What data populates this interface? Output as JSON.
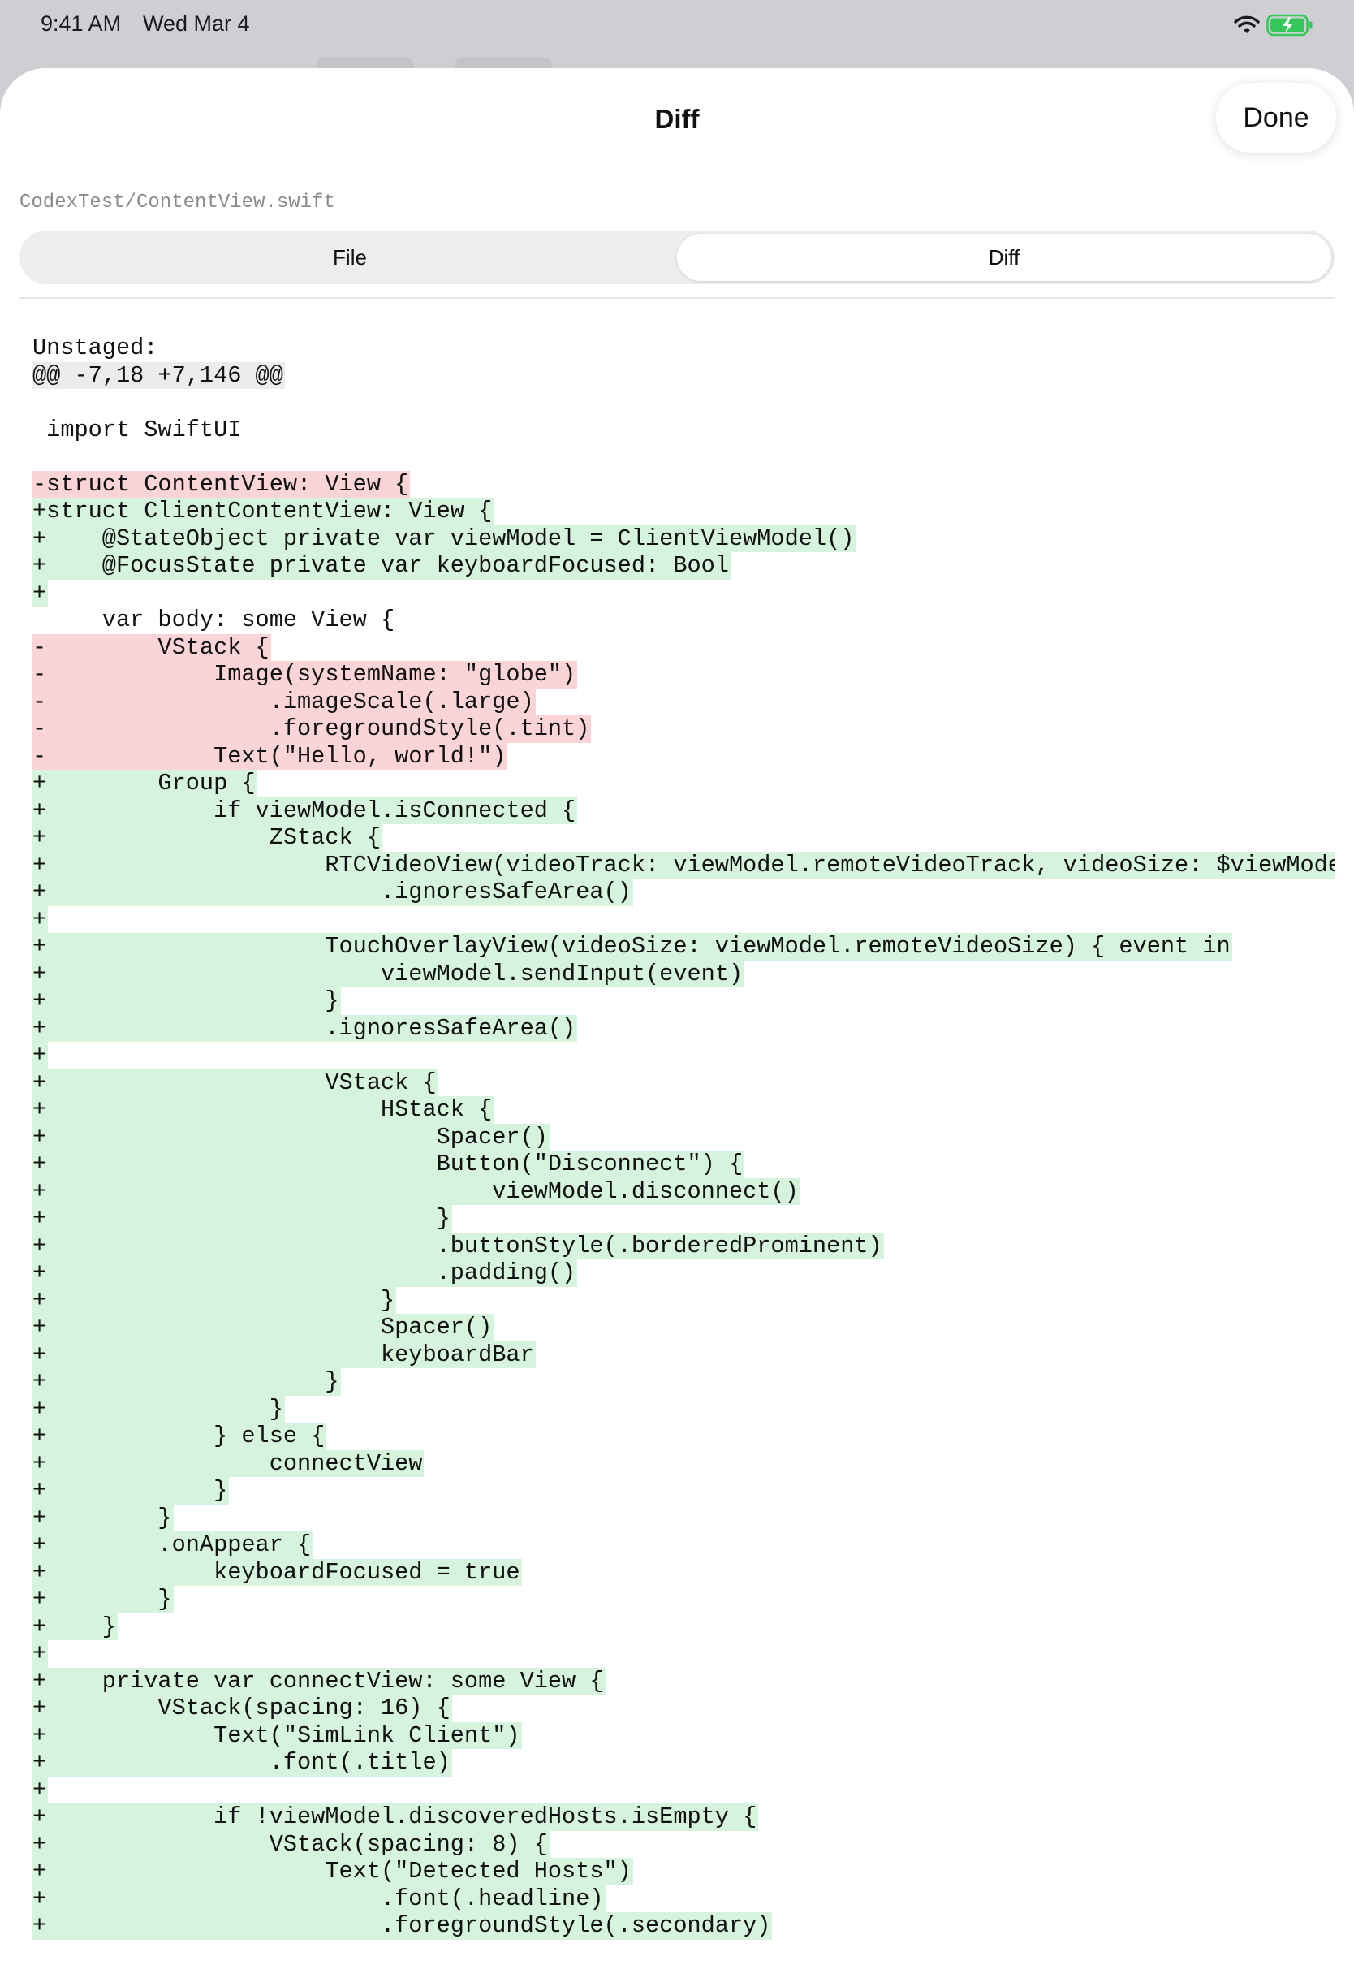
{
  "status_bar": {
    "time": "9:41 AM",
    "date": "Wed Mar 4"
  },
  "sheet": {
    "title": "Diff",
    "done_label": "Done",
    "file_path": "CodexTest/ContentView.swift"
  },
  "segments": {
    "file": "File",
    "diff": "Diff",
    "selected": "Diff"
  },
  "colors": {
    "added_bg": "#d5f3dd",
    "removed_bg": "#fad4d6",
    "hunk_bg": "#ececee",
    "battery": "#34c759"
  },
  "diff": {
    "lines": [
      {
        "type": "label",
        "text": "Unstaged:"
      },
      {
        "type": "hunk",
        "text": "@@ -7,18 +7,146 @@"
      },
      {
        "type": "blank",
        "text": ""
      },
      {
        "type": "ctx",
        "text": " import SwiftUI"
      },
      {
        "type": "blank",
        "text": ""
      },
      {
        "type": "del",
        "text": "-struct ContentView: View {"
      },
      {
        "type": "add",
        "text": "+struct ClientContentView: View {"
      },
      {
        "type": "add",
        "text": "+    @StateObject private var viewModel = ClientViewModel()"
      },
      {
        "type": "add",
        "text": "+    @FocusState private var keyboardFocused: Bool"
      },
      {
        "type": "add",
        "text": "+"
      },
      {
        "type": "ctx",
        "text": "     var body: some View {"
      },
      {
        "type": "del",
        "text": "-        VStack {"
      },
      {
        "type": "del",
        "text": "-            Image(systemName: \"globe\")"
      },
      {
        "type": "del",
        "text": "-                .imageScale(.large)"
      },
      {
        "type": "del",
        "text": "-                .foregroundStyle(.tint)"
      },
      {
        "type": "del",
        "text": "-            Text(\"Hello, world!\")"
      },
      {
        "type": "add",
        "text": "+        Group {"
      },
      {
        "type": "add",
        "text": "+            if viewModel.isConnected {"
      },
      {
        "type": "add",
        "text": "+                ZStack {"
      },
      {
        "type": "add",
        "text": "+                    RTCVideoView(videoTrack: viewModel.remoteVideoTrack, videoSize: $viewModel.remoteVideoSize)"
      },
      {
        "type": "add",
        "text": "+                        .ignoresSafeArea()"
      },
      {
        "type": "add",
        "text": "+"
      },
      {
        "type": "add",
        "text": "+                    TouchOverlayView(videoSize: viewModel.remoteVideoSize) { event in"
      },
      {
        "type": "add",
        "text": "+                        viewModel.sendInput(event)"
      },
      {
        "type": "add",
        "text": "+                    }"
      },
      {
        "type": "add",
        "text": "+                    .ignoresSafeArea()"
      },
      {
        "type": "add",
        "text": "+"
      },
      {
        "type": "add",
        "text": "+                    VStack {"
      },
      {
        "type": "add",
        "text": "+                        HStack {"
      },
      {
        "type": "add",
        "text": "+                            Spacer()"
      },
      {
        "type": "add",
        "text": "+                            Button(\"Disconnect\") {"
      },
      {
        "type": "add",
        "text": "+                                viewModel.disconnect()"
      },
      {
        "type": "add",
        "text": "+                            }"
      },
      {
        "type": "add",
        "text": "+                            .buttonStyle(.borderedProminent)"
      },
      {
        "type": "add",
        "text": "+                            .padding()"
      },
      {
        "type": "add",
        "text": "+                        }"
      },
      {
        "type": "add",
        "text": "+                        Spacer()"
      },
      {
        "type": "add",
        "text": "+                        keyboardBar"
      },
      {
        "type": "add",
        "text": "+                    }"
      },
      {
        "type": "add",
        "text": "+                }"
      },
      {
        "type": "add",
        "text": "+            } else {"
      },
      {
        "type": "add",
        "text": "+                connectView"
      },
      {
        "type": "add",
        "text": "+            }"
      },
      {
        "type": "add",
        "text": "+        }"
      },
      {
        "type": "add",
        "text": "+        .onAppear {"
      },
      {
        "type": "add",
        "text": "+            keyboardFocused = true"
      },
      {
        "type": "add",
        "text": "+        }"
      },
      {
        "type": "add",
        "text": "+    }"
      },
      {
        "type": "add",
        "text": "+"
      },
      {
        "type": "add",
        "text": "+    private var connectView: some View {"
      },
      {
        "type": "add",
        "text": "+        VStack(spacing: 16) {"
      },
      {
        "type": "add",
        "text": "+            Text(\"SimLink Client\")"
      },
      {
        "type": "add",
        "text": "+                .font(.title)"
      },
      {
        "type": "add",
        "text": "+"
      },
      {
        "type": "add",
        "text": "+            if !viewModel.discoveredHosts.isEmpty {"
      },
      {
        "type": "add",
        "text": "+                VStack(spacing: 8) {"
      },
      {
        "type": "add",
        "text": "+                    Text(\"Detected Hosts\")"
      },
      {
        "type": "add",
        "text": "+                        .font(.headline)"
      },
      {
        "type": "add",
        "text": "+                        .foregroundStyle(.secondary)"
      }
    ]
  }
}
